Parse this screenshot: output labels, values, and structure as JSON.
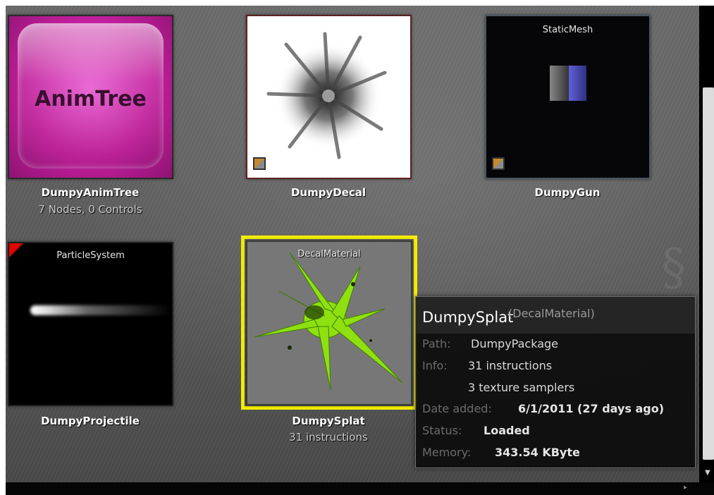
{
  "assets": [
    {
      "name": "DumpyAnimTree",
      "subtitle": "7 Nodes, 0 Controls",
      "thumb_text": "AnimTree"
    },
    {
      "name": "DumpyDecal",
      "subtitle": ""
    },
    {
      "name": "DumpyGun",
      "subtitle": "",
      "type_caption": "StaticMesh"
    },
    {
      "name": "DumpyProjectile",
      "subtitle": "",
      "type_caption": "ParticleSystem"
    },
    {
      "name": "DumpySplat",
      "subtitle": "31 instructions",
      "type_caption": "DecalMaterial",
      "selected": true
    }
  ],
  "tooltip": {
    "name": "DumpySplat",
    "type": "(DecalMaterial)",
    "path_label": "Path:",
    "path_value": "DumpyPackage",
    "info_label": "Info:",
    "info_value_1": "31 instructions",
    "info_value_2": "3 texture samplers",
    "date_label": "Date added:",
    "date_value": "6/1/2011 (27 days ago)",
    "status_label": "Status:",
    "status_value": "Loaded",
    "memory_label": "Memory:",
    "memory_value": "343.54 KByte"
  },
  "colors": {
    "selection": "#f4ee00",
    "animtree": "#c21f9c",
    "splat": "#8fe010",
    "modified_flag": "#e00000"
  },
  "icons": {
    "modified_flag": "red-corner-flag-icon",
    "source_badge": "orange-corner-badge-icon"
  }
}
